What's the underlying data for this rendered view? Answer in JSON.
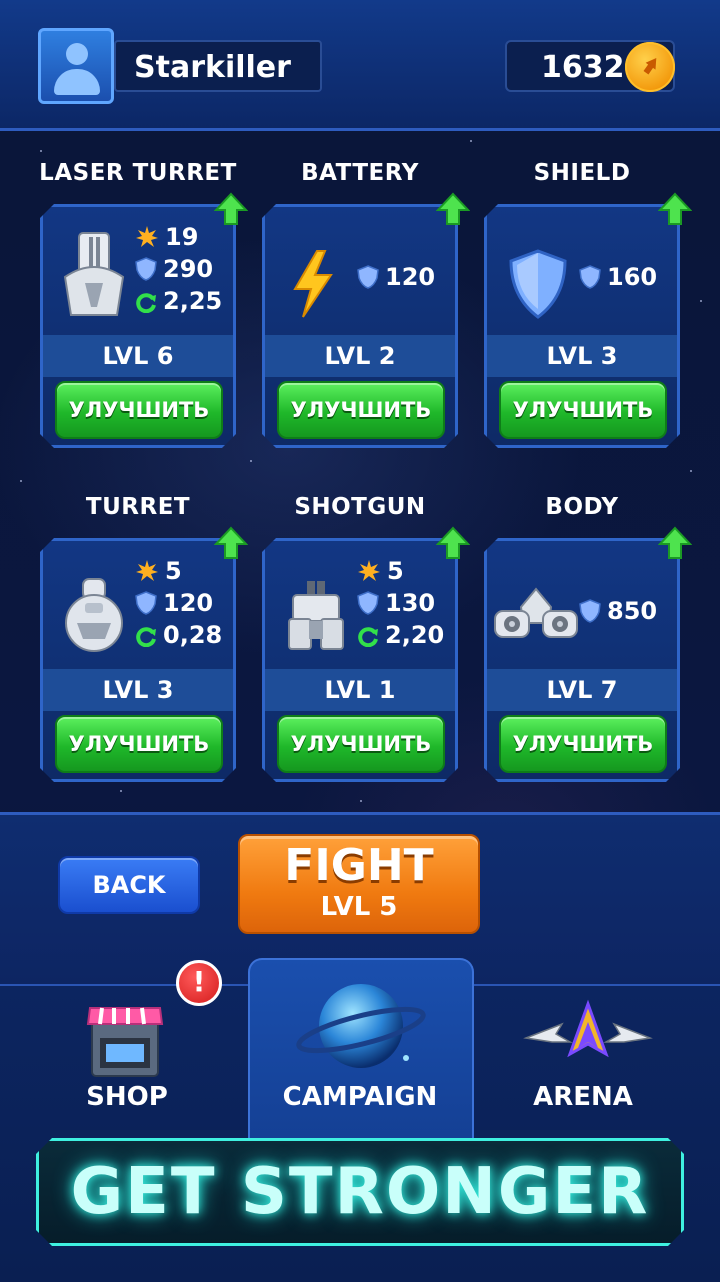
{
  "player": {
    "name": "Starkiller",
    "coins": "1632"
  },
  "cards": [
    {
      "title": "LASER TURRET",
      "level": "LVL 6",
      "upgrade_label": "УЛУЧШИТЬ",
      "damage": "19",
      "armor": "290",
      "rate": "2,25"
    },
    {
      "title": "BATTERY",
      "level": "LVL 2",
      "upgrade_label": "УЛУЧШИТЬ",
      "armor": "120"
    },
    {
      "title": "SHIELD",
      "level": "LVL 3",
      "upgrade_label": "УЛУЧШИТЬ",
      "armor": "160"
    },
    {
      "title": "TURRET",
      "level": "LVL 3",
      "upgrade_label": "УЛУЧШИТЬ",
      "damage": "5",
      "armor": "120",
      "rate": "0,28"
    },
    {
      "title": "SHOTGUN",
      "level": "LVL 1",
      "upgrade_label": "УЛУЧШИТЬ",
      "damage": "5",
      "armor": "130",
      "rate": "2,20"
    },
    {
      "title": "BODY",
      "level": "LVL 7",
      "upgrade_label": "УЛУЧШИТЬ",
      "armor": "850"
    }
  ],
  "actions": {
    "back_label": "BACK",
    "fight_label": "FIGHT",
    "fight_level": "LVL 5"
  },
  "tabs": [
    {
      "label": "SHOP",
      "badge": "!"
    },
    {
      "label": "CAMPAIGN",
      "active": true
    },
    {
      "label": "ARENA"
    }
  ],
  "banner": {
    "text": "GET STRONGER"
  },
  "colors": {
    "upgrade_green": "#1fb82a",
    "fight_orange": "#f07a10",
    "back_blue": "#1a4fcf",
    "banner_cyan": "#3ff0e0",
    "coin_gold": "#f39a0d"
  },
  "icons": {
    "damage": "explosion-icon",
    "armor": "shield-icon",
    "rate": "reload-icon",
    "upgrade": "up-arrow-icon"
  }
}
